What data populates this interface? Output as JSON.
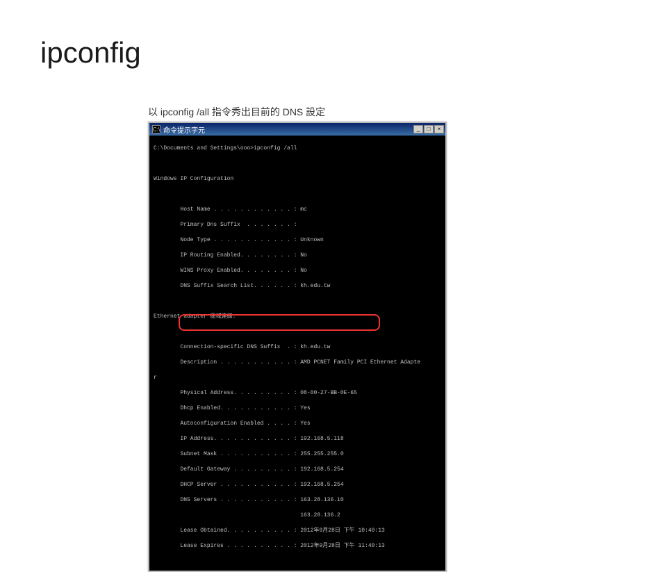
{
  "title": "ipconfig",
  "subtitle": "以 ipconfig /all 指令秀出目前的 DNS 設定",
  "window": {
    "titlebar": "命令提示字元",
    "min": "_",
    "max": "□",
    "close": "×"
  },
  "cmd": {
    "prompt": "C:\\Documents and Settings\\ooo>ipconfig /all",
    "heading1": "Windows IP Configuration",
    "section1": [
      "        Host Name . . . . . . . . . . . . : mc",
      "        Primary Dns Suffix  . . . . . . . :",
      "        Node Type . . . . . . . . . . . . : Unknown",
      "        IP Routing Enabled. . . . . . . . : No",
      "        WINS Proxy Enabled. . . . . . . . : No",
      "        DNS Suffix Search List. . . . . . : kh.edu.tw"
    ],
    "heading2": "Ethernet adapter 區域連線:",
    "section2": [
      "        Connection-specific DNS Suffix  . : kh.edu.tw",
      "        Description . . . . . . . . . . . : AMD PCNET Family PCI Ethernet Adapte",
      "r",
      "        Physical Address. . . . . . . . . : 08-00-27-BB-0E-65",
      "        Dhcp Enabled. . . . . . . . . . . : Yes",
      "        Autoconfiguration Enabled . . . . : Yes",
      "        IP Address. . . . . . . . . . . . : 192.168.5.118",
      "        Subnet Mask . . . . . . . . . . . : 255.255.255.0",
      "        Default Gateway . . . . . . . . . : 192.168.5.254",
      "        DHCP Server . . . . . . . . . . . : 192.168.5.254"
    ],
    "dns_lines": [
      "        DNS Servers . . . . . . . . . . . : 163.28.136.10",
      "                                            163.28.136.2"
    ],
    "lease": [
      "        Lease Obtained. . . . . . . . . . : 2012年9月28日 下午 10:40:13",
      "        Lease Expires . . . . . . . . . . : 2012年9月28日 下午 11:40:13"
    ]
  }
}
